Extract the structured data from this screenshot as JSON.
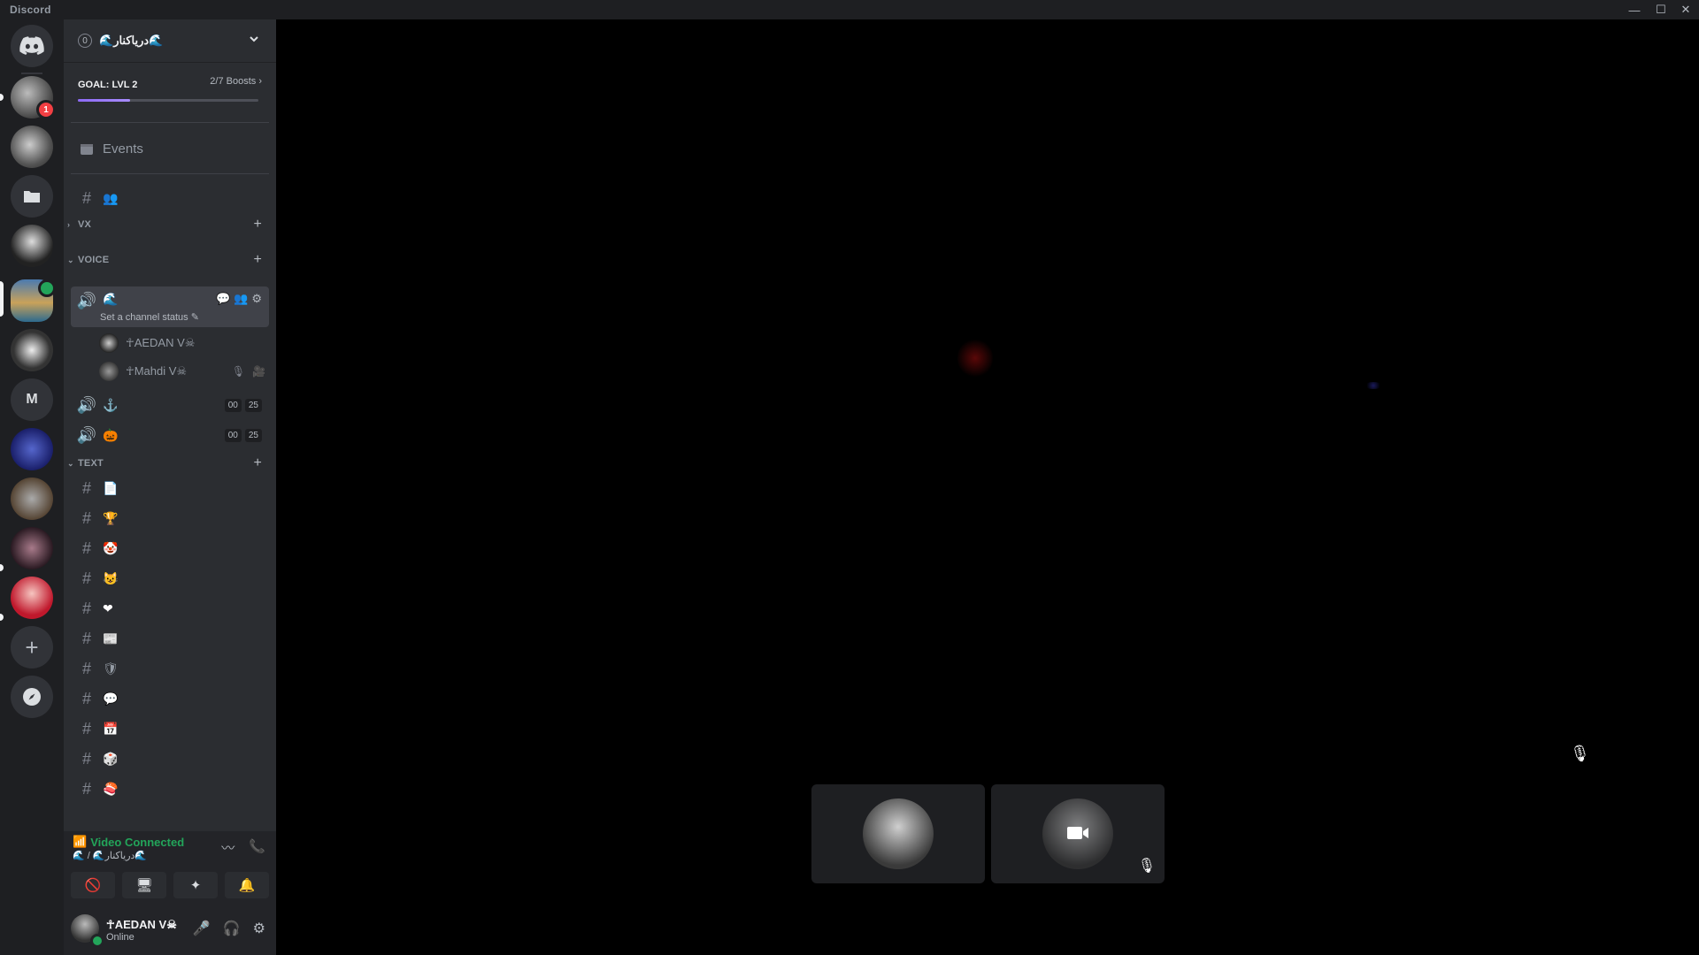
{
  "app": {
    "title": "Discord"
  },
  "window_controls": {
    "minimize": "—",
    "maximize": "☐",
    "close": "✕"
  },
  "rail": {
    "badge_count": "1",
    "letter_server": "M",
    "add": "+",
    "explore": "🧭"
  },
  "guild": {
    "member_count": "0",
    "name": "🌊دریاکنار🌊"
  },
  "boost": {
    "goal": "GOAL: LVL 2",
    "progress": "2/7 Boosts",
    "fraction": 0.29
  },
  "events": {
    "label": "Events"
  },
  "top_channel": {
    "emoji": "👥"
  },
  "categories": {
    "vx": "VX",
    "voice": "VOICE",
    "text": "TEXT"
  },
  "voice_channels": [
    {
      "emoji": "🌊",
      "status_hint": "Set a channel status"
    },
    {
      "emoji": "⚓",
      "pill_a": "00",
      "pill_b": "25"
    },
    {
      "emoji": "🎃",
      "pill_a": "00",
      "pill_b": "25"
    }
  ],
  "voice_users": [
    {
      "name": "☥AEDAN V☠"
    },
    {
      "name": "☥Mahdi V☠"
    }
  ],
  "text_channels": [
    {
      "emoji": "📄"
    },
    {
      "emoji": "🏆"
    },
    {
      "emoji": "🤡"
    },
    {
      "emoji": "😺"
    },
    {
      "emoji": "❤"
    },
    {
      "emoji": "📰"
    },
    {
      "emoji": "🛡"
    },
    {
      "emoji": "💬"
    },
    {
      "emoji": "📅"
    },
    {
      "emoji": "🎲"
    },
    {
      "emoji": "🍣"
    }
  ],
  "voice_panel": {
    "status": "Video Connected",
    "channel": "🌊 / 🌊دریاکنار🌊"
  },
  "user": {
    "name": "☥AEDAN V☠",
    "status": "Online"
  },
  "colors": {
    "connected": "#23a55a",
    "badge": "#f23f43",
    "sidebar": "#2b2d31",
    "rail": "#1e1f22"
  }
}
